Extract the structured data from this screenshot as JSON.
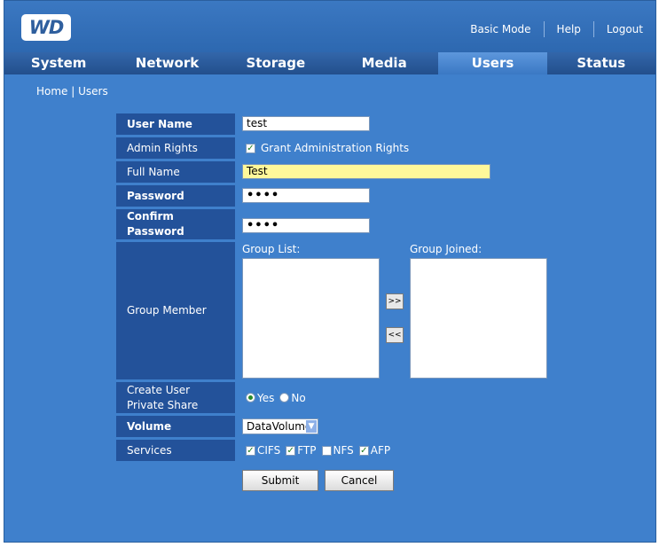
{
  "header": {
    "logo_text": "WD",
    "links": [
      "Basic Mode",
      "Help",
      "Logout"
    ]
  },
  "nav": {
    "tabs": [
      "System",
      "Network",
      "Storage",
      "Media",
      "Users",
      "Status"
    ],
    "active_tab": "Users"
  },
  "breadcrumb": {
    "home": "Home",
    "separator": "|",
    "current": "Users"
  },
  "form": {
    "user_name": {
      "label": "User Name",
      "value": "test"
    },
    "admin_rights": {
      "label": "Admin Rights",
      "checkbox_label": "Grant Administration Rights",
      "checked": true
    },
    "full_name": {
      "label": "Full Name",
      "value": "Test"
    },
    "password": {
      "label": "Password",
      "value": "••••"
    },
    "confirm_password": {
      "label_line1": "Confirm",
      "label_line2": "Password",
      "value": "••••"
    },
    "group_member": {
      "label": "Group Member",
      "group_list_label": "Group List:",
      "group_joined_label": "Group Joined:",
      "add_button": ">>",
      "remove_button": "<<"
    },
    "private_share": {
      "label_line1": "Create User",
      "label_line2": "Private Share",
      "yes": "Yes",
      "no": "No",
      "selected": "Yes"
    },
    "volume": {
      "label": "Volume",
      "value": "DataVolume"
    },
    "services": {
      "label": "Services",
      "items": [
        {
          "name": "CIFS",
          "checked": true
        },
        {
          "name": "FTP",
          "checked": true
        },
        {
          "name": "NFS",
          "checked": false
        },
        {
          "name": "AFP",
          "checked": true
        }
      ]
    },
    "submit_label": "Submit",
    "cancel_label": "Cancel"
  },
  "colors": {
    "background": "#3f80cc",
    "label_cell": "#23529a",
    "tab_bar": "#2a5a9c",
    "full_name_field": "#fff89a"
  }
}
